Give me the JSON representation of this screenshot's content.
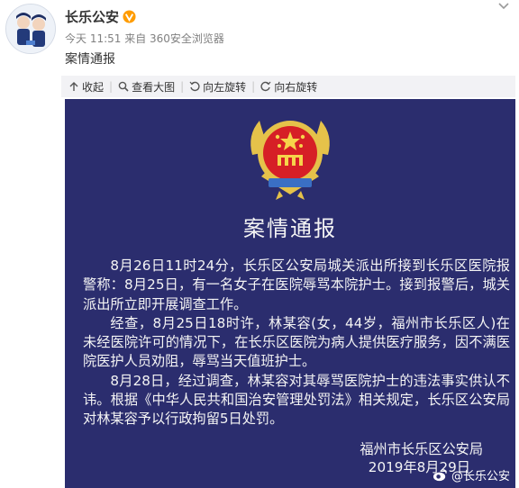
{
  "post": {
    "user_name": "长乐公安",
    "meta": "今天 11:51 来自 360安全浏览器",
    "text": "案情通报"
  },
  "toolbar": {
    "collapse_label": "收起",
    "view_large_label": "查看大图",
    "rotate_left_label": "向左旋转",
    "rotate_right_label": "向右旋转"
  },
  "image": {
    "title": "案情通报",
    "paragraphs": [
      "8月26日11时24分，长乐区公安局城关派出所接到长乐区医院报警称：8月25日，有一名女子在医院辱骂本院护士。接到报警后，城关派出所立即开展调查工作。",
      "经查，8月25日18时许，林某容(女，44岁，福州市长乐区人)在未经医院许可的情况下，在长乐区医院为病人提供医疗服务，因不满医院医护人员劝阻，辱骂当天值班护士。",
      "8月28日，经过调查，林某容对其辱骂医院护士的违法事实供认不讳。根据《中华人民共和国治安管理处罚法》相关规定，长乐区公安局对林某容予以行政拘留5日处罚。"
    ],
    "signature_org": "福州市长乐区公安局",
    "signature_date": "2019年8月29日",
    "watermark": "@长乐公安"
  },
  "colors": {
    "image_bg": "#2b2d6e",
    "toolbar_bg": "#f2f2f5",
    "verify_badge": "#ff9c00"
  }
}
